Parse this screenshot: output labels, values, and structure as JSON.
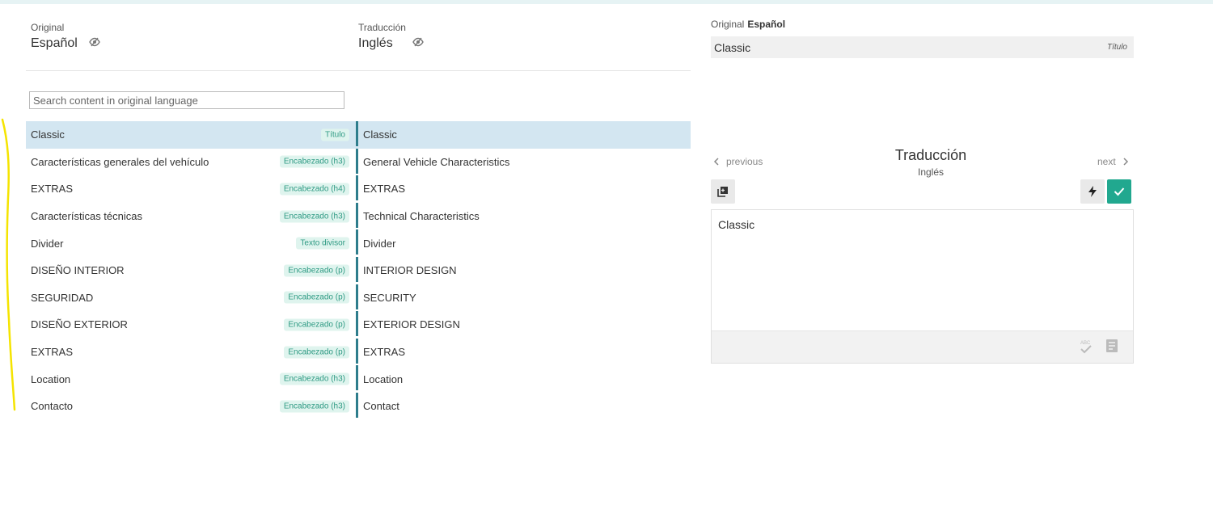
{
  "header": {
    "original_small": "Original",
    "original_lang": "Español",
    "translation_small": "Traducción",
    "translation_lang": "Inglés"
  },
  "search": {
    "placeholder": "Search content in original language"
  },
  "rows": [
    {
      "original": "Classic",
      "tag": "Título",
      "translation": "Classic"
    },
    {
      "original": "Características generales del vehículo",
      "tag": "Encabezado (h3)",
      "translation": "General Vehicle Characteristics"
    },
    {
      "original": "EXTRAS",
      "tag": "Encabezado (h4)",
      "translation": "EXTRAS"
    },
    {
      "original": "Características técnicas",
      "tag": "Encabezado (h3)",
      "translation": "Technical Characteristics"
    },
    {
      "original": "Divider",
      "tag": "Texto divisor",
      "translation": "Divider"
    },
    {
      "original": "DISEÑO INTERIOR",
      "tag": "Encabezado (p)",
      "translation": "INTERIOR DESIGN"
    },
    {
      "original": "SEGURIDAD",
      "tag": "Encabezado (p)",
      "translation": "SECURITY"
    },
    {
      "original": "DISEÑO EXTERIOR",
      "tag": "Encabezado (p)",
      "translation": "EXTERIOR DESIGN"
    },
    {
      "original": "EXTRAS",
      "tag": "Encabezado (p)",
      "translation": "EXTRAS"
    },
    {
      "original": "Location",
      "tag": "Encabezado (h3)",
      "translation": "Location"
    },
    {
      "original": "Contacto",
      "tag": "Encabezado (h3)",
      "translation": "Contact"
    }
  ],
  "selected_row": 0,
  "panel": {
    "original_label": "Original",
    "original_lang": "Español",
    "source_text": "Classic",
    "source_type": "Título",
    "prev_label": "previous",
    "next_label": "next",
    "title": "Traducción",
    "subtitle": "Inglés",
    "editor_text": "Classic"
  },
  "icons": {
    "visibility_toggle": "eye-off-icon",
    "copy": "copy-source-icon",
    "machine_translate": "lightning-icon",
    "confirm": "check-icon",
    "spellcheck": "spellcheck-icon",
    "glossary": "glossary-icon"
  },
  "colors": {
    "accent": "#21a88f",
    "selected_row": "#d3e6f1",
    "separator": "#2e7d8c",
    "tag_bg": "#dff4ee",
    "tag_text": "#2e9a83",
    "annotation": "#f5e400"
  }
}
